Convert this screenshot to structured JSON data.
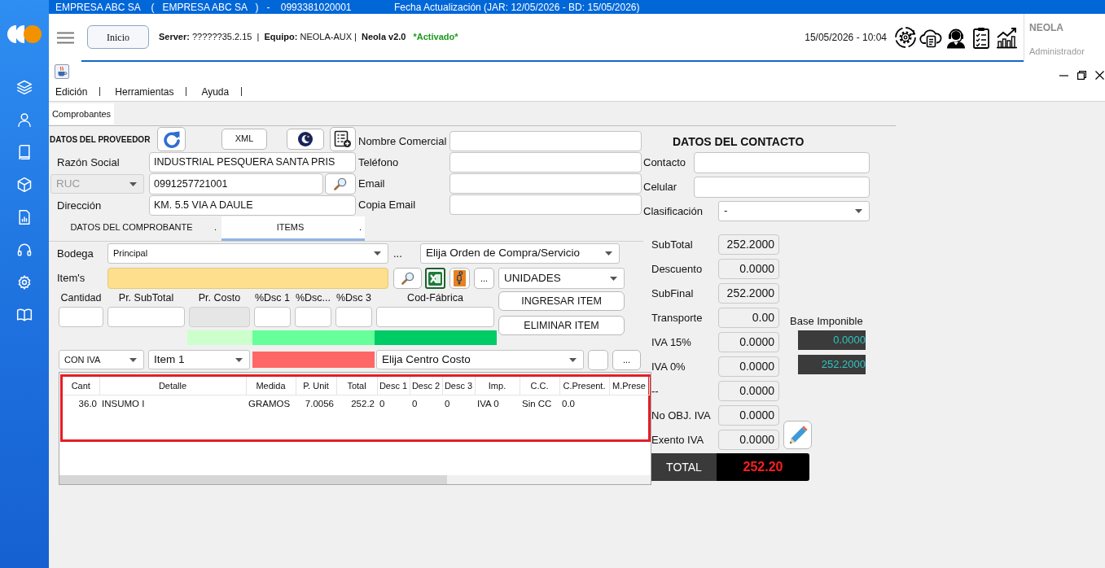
{
  "top_bar": {
    "company": "EMPRESA ABC SA    (   EMPRESA ABC SA   )   -    0993381020001",
    "update_info": "Fecha Actualización (JAR: 12/05/2026 - BD: 15/05/2026)"
  },
  "header": {
    "home_button": "Inicio",
    "server_info": "**Server:** ??????35.2.15  |  **Equipo:** NEOLA-AUX |  **Neola v2.0**",
    "activation": "*Activado*",
    "datetime": "15/05/2026 - 10:04",
    "user_name": "NEOLA",
    "user_role": "Administrador"
  },
  "window": {
    "menu": [
      "Edición",
      "Herramientas",
      "Ayuda"
    ]
  },
  "tabs": [
    {
      "label": "Comprobantes",
      "selected": true
    }
  ],
  "provider": {
    "title": "DATOS DEL PROVEEDOR",
    "xml_button": "XML",
    "business_name": {
      "label": "Razón Social",
      "value": "INDUSTRIAL PESQUERA SANTA PRIS"
    },
    "id_type": {
      "value": "RUC",
      "disabled": true
    },
    "id_number": "0991257721001",
    "address": {
      "label": "Dirección",
      "value": "KM. 5.5 VIA A DAULE"
    }
  },
  "commercial_fields": [
    {
      "label": "Nombre Comercial"
    },
    {
      "label": "Teléfono"
    },
    {
      "label": "Email"
    },
    {
      "label": "Copia Email"
    }
  ],
  "contact": {
    "title": "DATOS DEL CONTACTO",
    "fields": [
      {
        "kind": "text",
        "label": "Contacto"
      },
      {
        "kind": "text",
        "label": "Celular"
      },
      {
        "kind": "select",
        "label": "Clasificación",
        "value": "-"
      }
    ]
  },
  "section_tabs": [
    {
      "label": "DATOS DEL COMPROBANTE",
      "suffix": ".",
      "selected": false
    },
    {
      "label": "ITEMS",
      "suffix": ".",
      "selected": true
    }
  ],
  "items_panel": {
    "warehouse": {
      "label": "Bodega",
      "value": "Principal"
    },
    "warehouse_more": "...",
    "order_select": "Elija Orden de Compra/Servicio",
    "item_label": "Item's",
    "item_more_button": "...",
    "unit_select": "UNIDADES",
    "entry_fields": [
      {
        "label": "Cantidad",
        "disabled": false
      },
      {
        "label": "Pr. SubTotal",
        "disabled": false
      },
      {
        "label": "Pr. Costo",
        "disabled": true
      },
      {
        "label": "%Dsc 1",
        "disabled": false
      },
      {
        "label": "%Dsc...",
        "disabled": false
      },
      {
        "label": "%Dsc 3",
        "disabled": false
      },
      {
        "label": "Cod-Fábrica",
        "disabled": false
      }
    ],
    "buttons": [
      "INGRESAR ITEM",
      "ELIMINAR ITEM"
    ],
    "indicator_strips": [
      {
        "color": "#ccffcc"
      },
      {
        "color": "#66ff99"
      },
      {
        "color": "#00cc66"
      }
    ],
    "tax_select": "CON IVA",
    "line_select": "Item 1",
    "alert_strip": {
      "color": "#ff6666"
    },
    "cost_center_select": "Elija Centro Costo",
    "cost_center_more_button": "..."
  },
  "table": {
    "highlighted": true,
    "columns": [
      "Cant",
      "Detalle",
      "Medida",
      "P. Unit",
      "Total",
      "Desc 1",
      "Desc 2",
      "Desc 3",
      "Imp.",
      "C.C.",
      "C.Present.",
      "M.Prese"
    ],
    "rows": [
      [
        "36.0",
        "INSUMO I",
        "GRAMOS",
        "7.0056",
        "252.2",
        "0",
        "0",
        "0",
        "IVA 0",
        "Sin CC",
        "0.0"
      ]
    ]
  },
  "totals": {
    "rows": [
      {
        "label": "SubTotal",
        "value": "252.2000"
      },
      {
        "label": "Descuento",
        "value": "0.0000"
      },
      {
        "label": "SubFinal",
        "value": "252.2000"
      },
      {
        "label": "Transporte",
        "value": "0.00"
      },
      {
        "label": "IVA 15%",
        "value": "0.0000"
      },
      {
        "label": "IVA 0%",
        "value": "0.0000"
      },
      {
        "label": "--",
        "value": "0.0000"
      },
      {
        "label": "No OBJ. IVA",
        "value": "0.0000"
      },
      {
        "label": "Exento IVA",
        "value": "0.0000"
      }
    ],
    "tax_base": {
      "label": "Base Imponible",
      "values": [
        "0.0000",
        "252.2000"
      ]
    },
    "total": {
      "label": "TOTAL",
      "value": "252.20"
    }
  }
}
